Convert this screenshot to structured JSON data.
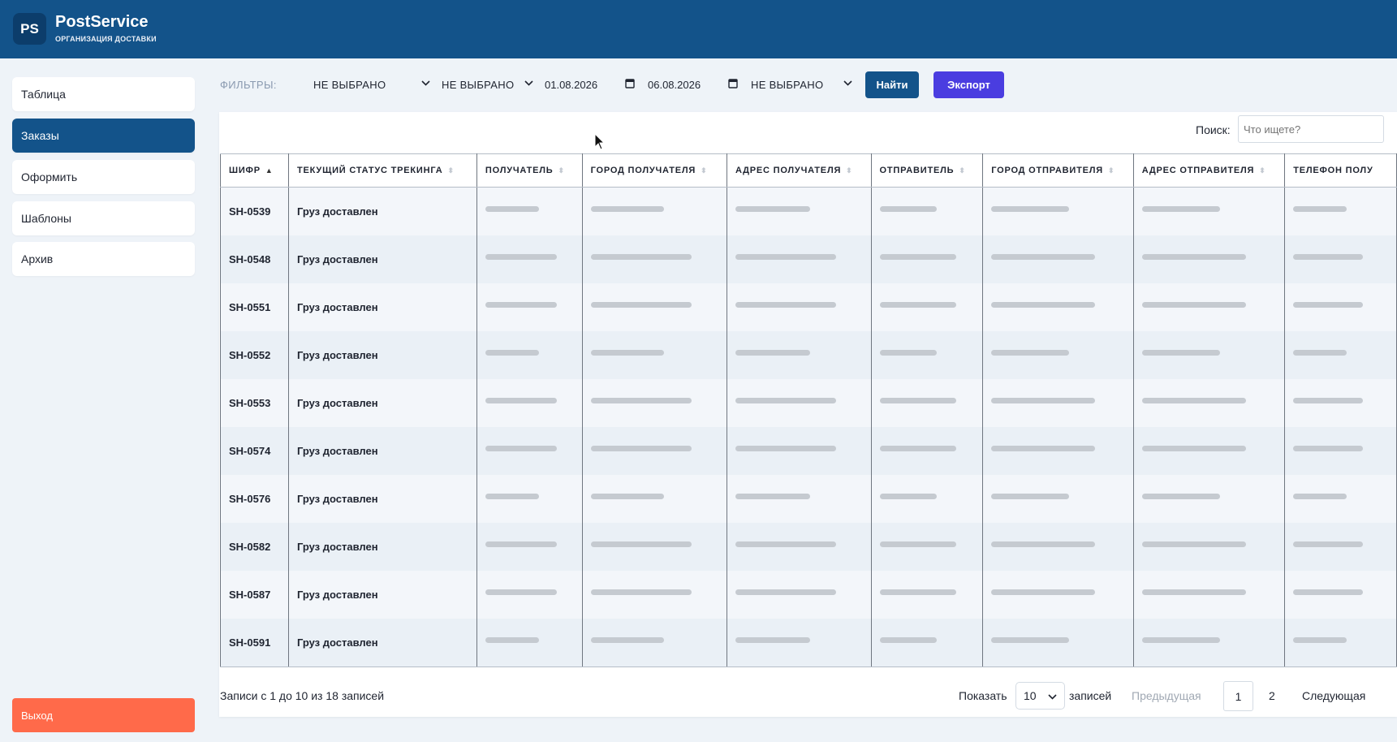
{
  "header": {
    "logo": "PS",
    "title": "PostService",
    "subtitle": "ОРГАНИЗАЦИЯ ДОСТАВКИ",
    "bg_color": "#13538a"
  },
  "sidebar": {
    "items": [
      {
        "label": "Таблица",
        "active": false
      },
      {
        "label": "Заказы",
        "active": true
      },
      {
        "label": "Оформить",
        "active": false
      },
      {
        "label": "Шаблоны",
        "active": false
      },
      {
        "label": "Архив",
        "active": false
      }
    ],
    "logout": "Выход",
    "logout_color": "#ff6a4a"
  },
  "filters": {
    "label": "ФИЛЬТРЫ:",
    "select1": "НЕ ВЫБРАНО",
    "select2": "НЕ ВЫБРАНО",
    "date_from": "01.08.2026",
    "date_to": "06.08.2026",
    "select3": "НЕ ВЫБРАНО",
    "find_button": "Найти",
    "export_button": "Экспорт",
    "export_color": "#4a3de0"
  },
  "search": {
    "label": "Поиск:",
    "placeholder": "Что ищете?"
  },
  "table": {
    "columns": [
      "ШИФР",
      "ТЕКУЩИЙ СТАТУС ТРЕКИНГА",
      "ПОЛУЧАТЕЛЬ",
      "ГОРОД ПОЛУЧАТЕЛЯ",
      "АДРЕС ПОЛУЧАТЕЛЯ",
      "ОТПРАВИТЕЛЬ",
      "ГОРОД ОТПРАВИТЕЛЯ",
      "АДРЕС ОТПРАВИТЕЛЯ",
      "ТЕЛЕФОН ПОЛУ"
    ],
    "sorted_column": "ШИФР",
    "rows": [
      {
        "code": "SH-0539",
        "status": "Груз доставлен"
      },
      {
        "code": "SH-0548",
        "status": "Груз доставлен"
      },
      {
        "code": "SH-0551",
        "status": "Груз доставлен"
      },
      {
        "code": "SH-0552",
        "status": "Груз доставлен"
      },
      {
        "code": "SH-0553",
        "status": "Груз доставлен"
      },
      {
        "code": "SH-0574",
        "status": "Груз доставлен"
      },
      {
        "code": "SH-0576",
        "status": "Груз доставлен"
      },
      {
        "code": "SH-0582",
        "status": "Груз доставлен"
      },
      {
        "code": "SH-0587",
        "status": "Груз доставлен"
      },
      {
        "code": "SH-0591",
        "status": "Груз доставлен"
      }
    ]
  },
  "footer": {
    "info": "Записи с 1 до 10 из 18 записей",
    "show_label": "Показать",
    "page_length": "10",
    "records_label": "записей",
    "prev": "Предыдущая",
    "pages": [
      "1",
      "2"
    ],
    "current_page": "1",
    "next": "Следующая"
  }
}
